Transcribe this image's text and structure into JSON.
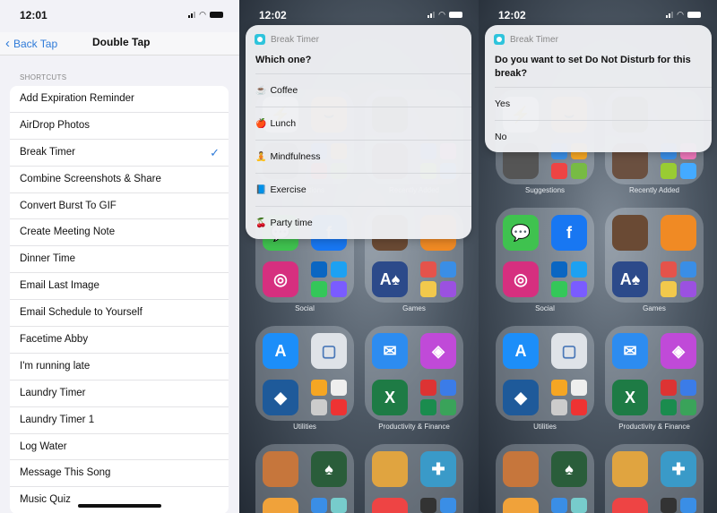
{
  "left": {
    "time": "12:01",
    "back_label": "Back Tap",
    "title": "Double Tap",
    "section": "SHORTCUTS",
    "items": [
      "Add Expiration Reminder",
      "AirDrop Photos",
      "Break Timer",
      "Combine Screenshots & Share",
      "Convert Burst To GIF",
      "Create Meeting Note",
      "Dinner Time",
      "Email Last Image",
      "Email Schedule to Yourself",
      "Facetime Abby",
      "I'm running late",
      "Laundry Timer",
      "Laundry Timer 1",
      "Log Water",
      "Message This Song",
      "Music Quiz"
    ],
    "selected": "Break Timer",
    "check": "✓"
  },
  "middle": {
    "time": "12:02",
    "app": "Break Timer",
    "question": "Which one?",
    "options": [
      {
        "emoji": "☕",
        "label": "Coffee"
      },
      {
        "emoji": "🍎",
        "label": "Lunch"
      },
      {
        "emoji": "🧘",
        "label": "Mindfulness"
      },
      {
        "emoji": "📘",
        "label": "Exercise"
      },
      {
        "emoji": "🍒",
        "label": "Party time"
      }
    ]
  },
  "right": {
    "time": "12:02",
    "app": "Break Timer",
    "question": "Do you want to set Do Not Disturb for this break?",
    "options": [
      "Yes",
      "No"
    ]
  },
  "home": {
    "folders": [
      {
        "label": "Suggestions",
        "icons": [
          {
            "c": "#e8e8e8",
            "t": "⚡",
            "fg": "#e33"
          },
          {
            "c": "#e9a94a",
            "t": "⌣",
            "fg": "#222"
          },
          {
            "c": "#555",
            "t": ""
          }
        ],
        "small": [
          "#3a8ee6",
          "#f5a623",
          "#e44",
          "#7b4"
        ]
      },
      {
        "label": "Recently Added",
        "icons": [
          {
            "c": "#4a3a30",
            "t": ""
          },
          {
            "c": "#777",
            "t": ""
          },
          {
            "c": "#6b5040",
            "t": ""
          }
        ],
        "small": [
          "#3a8ee6",
          "#e7b",
          "#9c3",
          "#4af"
        ]
      },
      {
        "label": "Social",
        "icons": [
          {
            "c": "#3fc24f",
            "t": "💬"
          },
          {
            "c": "#1877f2",
            "t": "f"
          },
          {
            "c": "#d62f7f",
            "t": "◎"
          }
        ],
        "small": [
          "#0a66c2",
          "#1da1f2",
          "#34c759",
          "#7a5cff"
        ]
      },
      {
        "label": "Games",
        "icons": [
          {
            "c": "#6a4a34",
            "t": ""
          },
          {
            "c": "#f08a24",
            "t": ""
          },
          {
            "c": "#2c4a8a",
            "t": "A♠"
          }
        ],
        "small": [
          "#e5534b",
          "#3a8ee6",
          "#f2c94c",
          "#9b51e0"
        ]
      },
      {
        "label": "Utilities",
        "icons": [
          {
            "c": "#1c8ef9",
            "t": "A"
          },
          {
            "c": "#dfe3e8",
            "t": "▢",
            "fg": "#4a78b8"
          },
          {
            "c": "#1e5a9a",
            "t": "◆"
          }
        ],
        "small": [
          "#f5a623",
          "#eee",
          "#ccc",
          "#e33"
        ]
      },
      {
        "label": "Productivity & Finance",
        "icons": [
          {
            "c": "#2d8cf0",
            "t": "✉"
          },
          {
            "c": "#c04ad8",
            "t": "◈"
          },
          {
            "c": "#1e7b45",
            "t": "X"
          }
        ],
        "small": [
          "#d33",
          "#3b7ce8",
          "#1a8c4e",
          "#3aa35a"
        ]
      },
      {
        "label": "",
        "icons": [
          {
            "c": "#c6763c",
            "t": ""
          },
          {
            "c": "#2a5d3a",
            "t": "♠"
          },
          {
            "c": "#f0a23a",
            "t": ""
          }
        ],
        "small": [
          "#3a8ee6",
          "#7cc",
          "#e33",
          "#5b5"
        ]
      },
      {
        "label": "",
        "icons": [
          {
            "c": "#e0a440",
            "t": ""
          },
          {
            "c": "#3a9ac8",
            "t": "✚"
          },
          {
            "c": "#e44",
            "t": ""
          }
        ],
        "small": [
          "#333",
          "#3a8ee6",
          "#e5a",
          "#9c3"
        ]
      }
    ]
  }
}
